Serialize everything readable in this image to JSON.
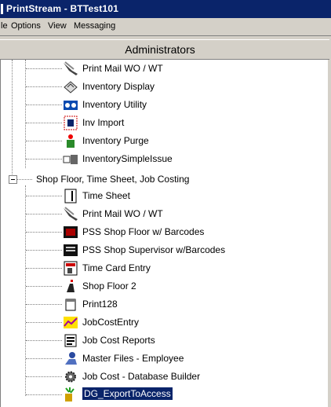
{
  "window": {
    "title": "PrintStream - BTTest101"
  },
  "menu": [
    "le",
    "Options",
    "View",
    "Messaging"
  ],
  "panel": {
    "title": "Administrators"
  },
  "tree": {
    "group_label": "Shop Floor, Time Sheet, Job Costing",
    "items_above": [
      {
        "label": "Print Mail WO / WT",
        "icon": "mail-printer-icon"
      },
      {
        "label": "Inventory Display",
        "icon": "boxes-icon"
      },
      {
        "label": "Inventory Utility",
        "icon": "utility-icon"
      },
      {
        "label": "Inv Import",
        "icon": "import-icon"
      },
      {
        "label": "Inventory Purge",
        "icon": "purge-icon"
      },
      {
        "label": "InventorySimpleIssue",
        "icon": "issue-icon"
      }
    ],
    "group_items": [
      {
        "label": "Time Sheet",
        "icon": "document-icon"
      },
      {
        "label": "Print Mail WO / WT",
        "icon": "mail-printer-icon"
      },
      {
        "label": "PSS Shop Floor w/ Barcodes",
        "icon": "monitor-icon"
      },
      {
        "label": "PSS Shop Supervisor w/Barcodes",
        "icon": "monitor-icon"
      },
      {
        "label": "Time Card Entry",
        "icon": "time-card-icon"
      },
      {
        "label": "Shop Floor 2",
        "icon": "shop-floor-icon"
      },
      {
        "label": "Print128",
        "icon": "page-icon"
      },
      {
        "label": "JobCostEntry",
        "icon": "chart-icon"
      },
      {
        "label": "Job Cost Reports",
        "icon": "report-icon"
      },
      {
        "label": "Master Files - Employee",
        "icon": "employee-icon"
      },
      {
        "label": "Job Cost - Database Builder",
        "icon": "gear-icon"
      },
      {
        "label": "DG_ExportToAccess",
        "icon": "export-icon",
        "selected": true
      }
    ]
  }
}
